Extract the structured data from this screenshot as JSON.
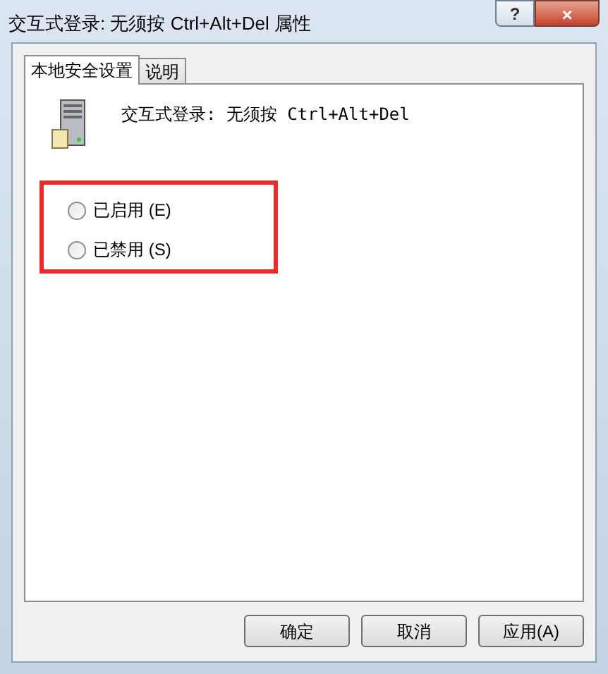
{
  "window": {
    "title": "交互式登录: 无须按 Ctrl+Alt+Del 属性",
    "buttons": [
      "?",
      "×"
    ]
  },
  "tabs": [
    {
      "label": "本地安全设置",
      "selected": true
    },
    {
      "label": "说明",
      "selected": false
    }
  ],
  "policy": {
    "name": "交互式登录: 无须按 Ctrl+Alt+Del"
  },
  "options": [
    {
      "label": "已启用 (E)",
      "selected": false
    },
    {
      "label": "已禁用 (S)",
      "selected": false
    }
  ],
  "buttons": [
    "确定",
    "取消",
    "应用(A)"
  ]
}
